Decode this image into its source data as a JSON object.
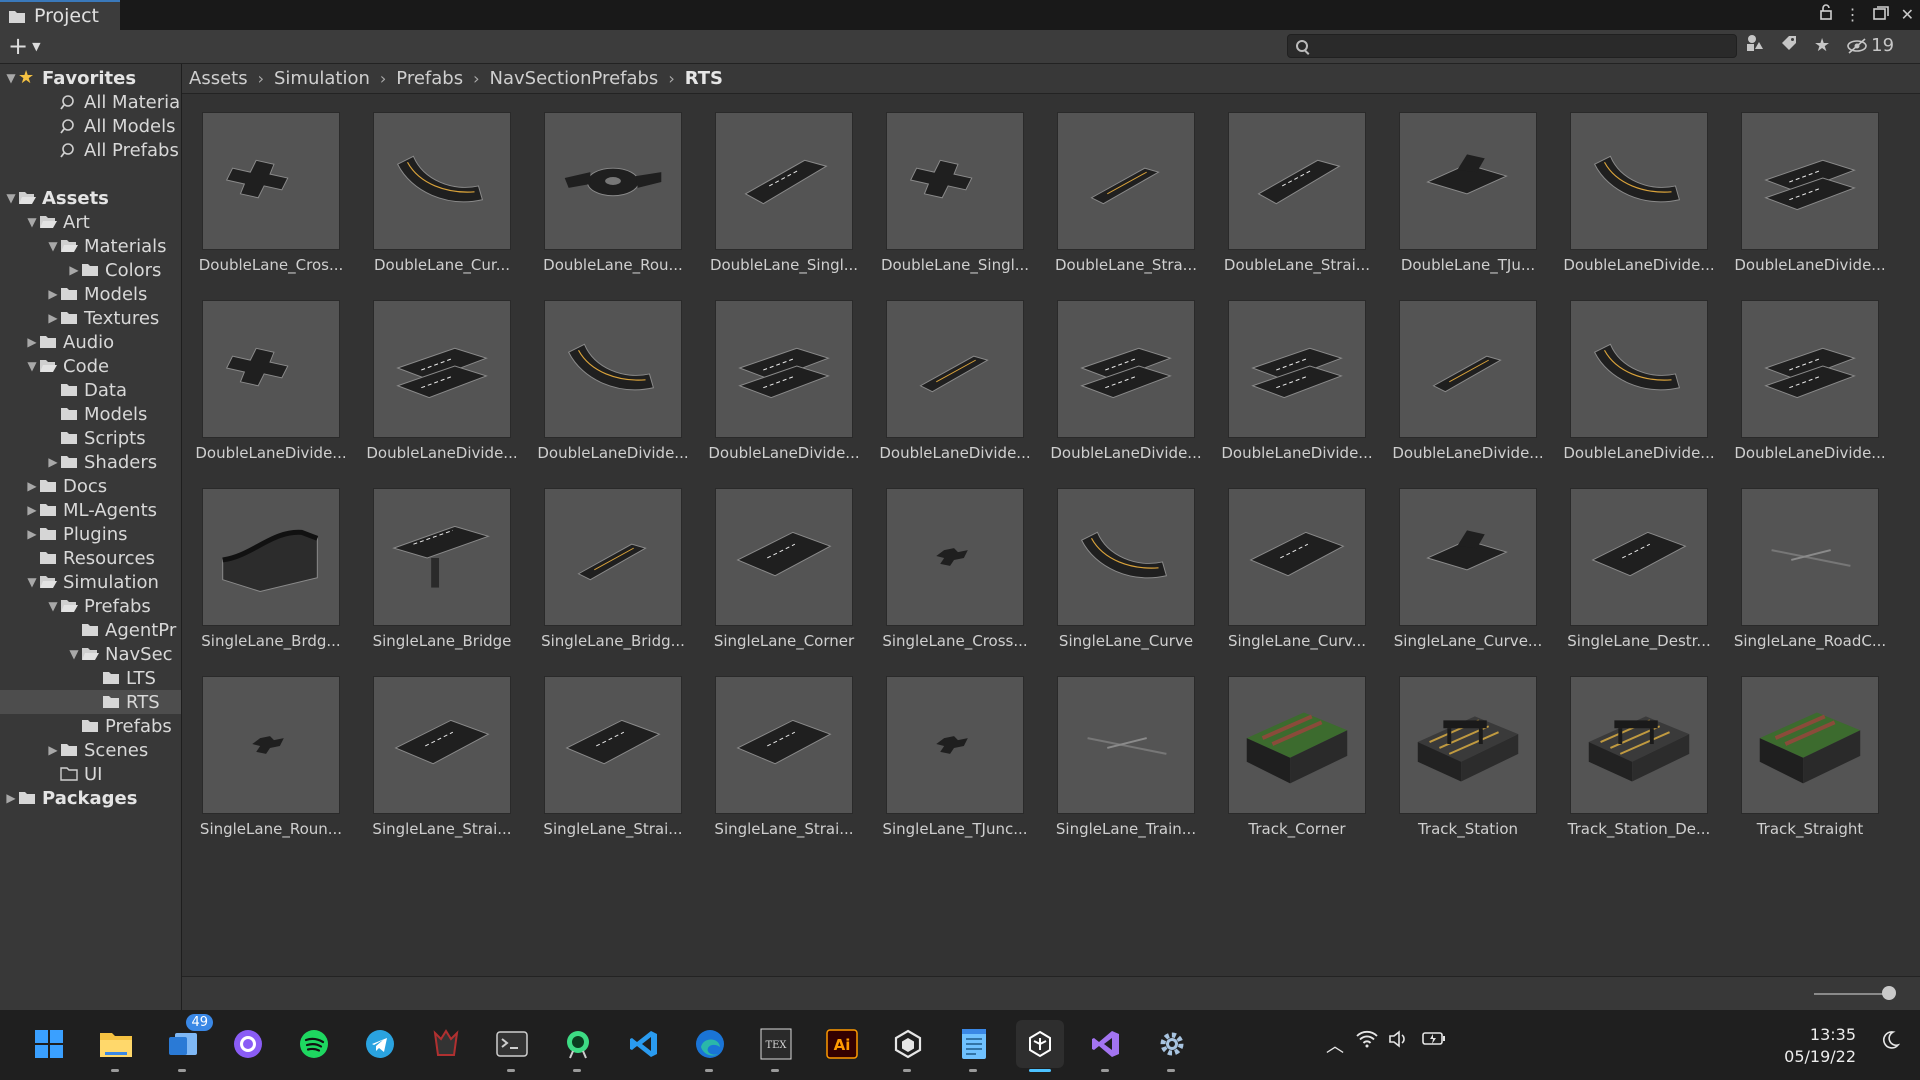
{
  "window": {
    "tab_label": "Project",
    "tab_icon": "folder-icon"
  },
  "toolbar": {
    "add_label": "+",
    "search_placeholder": "",
    "hidden_count": "19"
  },
  "sidebar": {
    "items": [
      {
        "label": "Favorites",
        "depth": 0,
        "arrow": "open",
        "icon": "star",
        "bold": true
      },
      {
        "label": "All Materials",
        "depth": 2,
        "arrow": "",
        "icon": "search"
      },
      {
        "label": "All Models",
        "depth": 2,
        "arrow": "",
        "icon": "search"
      },
      {
        "label": "All Prefabs",
        "depth": 2,
        "arrow": "",
        "icon": "search"
      },
      {
        "label": "",
        "depth": 0,
        "arrow": "",
        "icon": "none"
      },
      {
        "label": "Assets",
        "depth": 0,
        "arrow": "open",
        "icon": "folder-open",
        "bold": true
      },
      {
        "label": "Art",
        "depth": 1,
        "arrow": "open",
        "icon": "folder-open"
      },
      {
        "label": "Materials",
        "depth": 2,
        "arrow": "open",
        "icon": "folder-open"
      },
      {
        "label": "Colors",
        "depth": 3,
        "arrow": "closed",
        "icon": "folder"
      },
      {
        "label": "Models",
        "depth": 2,
        "arrow": "closed",
        "icon": "folder"
      },
      {
        "label": "Textures",
        "depth": 2,
        "arrow": "closed",
        "icon": "folder"
      },
      {
        "label": "Audio",
        "depth": 1,
        "arrow": "closed",
        "icon": "folder"
      },
      {
        "label": "Code",
        "depth": 1,
        "arrow": "open",
        "icon": "folder-open"
      },
      {
        "label": "Data",
        "depth": 2,
        "arrow": "",
        "icon": "folder"
      },
      {
        "label": "Models",
        "depth": 2,
        "arrow": "",
        "icon": "folder"
      },
      {
        "label": "Scripts",
        "depth": 2,
        "arrow": "",
        "icon": "folder"
      },
      {
        "label": "Shaders",
        "depth": 2,
        "arrow": "closed",
        "icon": "folder"
      },
      {
        "label": "Docs",
        "depth": 1,
        "arrow": "closed",
        "icon": "folder"
      },
      {
        "label": "ML-Agents",
        "depth": 1,
        "arrow": "closed",
        "icon": "folder"
      },
      {
        "label": "Plugins",
        "depth": 1,
        "arrow": "closed",
        "icon": "folder"
      },
      {
        "label": "Resources",
        "depth": 1,
        "arrow": "",
        "icon": "folder"
      },
      {
        "label": "Simulation",
        "depth": 1,
        "arrow": "open",
        "icon": "folder-open"
      },
      {
        "label": "Prefabs",
        "depth": 2,
        "arrow": "open",
        "icon": "folder-open"
      },
      {
        "label": "AgentPr",
        "depth": 3,
        "arrow": "",
        "icon": "folder"
      },
      {
        "label": "NavSec",
        "depth": 3,
        "arrow": "open",
        "icon": "folder-open"
      },
      {
        "label": "LTS",
        "depth": 4,
        "arrow": "",
        "icon": "folder"
      },
      {
        "label": "RTS",
        "depth": 4,
        "arrow": "",
        "icon": "folder",
        "selected": true
      },
      {
        "label": "Prefabs",
        "depth": 3,
        "arrow": "",
        "icon": "folder"
      },
      {
        "label": "Scenes",
        "depth": 2,
        "arrow": "closed",
        "icon": "folder"
      },
      {
        "label": "UI",
        "depth": 2,
        "arrow": "",
        "icon": "folder-empty"
      },
      {
        "label": "Packages",
        "depth": 0,
        "arrow": "closed",
        "icon": "folder",
        "bold": true
      }
    ]
  },
  "breadcrumb": [
    "Assets",
    "Simulation",
    "Prefabs",
    "NavSectionPrefabs",
    "RTS"
  ],
  "assets": [
    {
      "name": "DoubleLane_Cros...",
      "shape": "cross"
    },
    {
      "name": "DoubleLane_Cur...",
      "shape": "curve"
    },
    {
      "name": "DoubleLane_Rou...",
      "shape": "round"
    },
    {
      "name": "DoubleLane_Singl...",
      "shape": "wide"
    },
    {
      "name": "DoubleLane_Singl...",
      "shape": "cross"
    },
    {
      "name": "DoubleLane_Stra...",
      "shape": "strip"
    },
    {
      "name": "DoubleLane_Strai...",
      "shape": "wide"
    },
    {
      "name": "DoubleLane_TJu...",
      "shape": "tj"
    },
    {
      "name": "DoubleLaneDivide...",
      "shape": "curve"
    },
    {
      "name": "DoubleLaneDivide...",
      "shape": "double"
    },
    {
      "name": "DoubleLaneDivide...",
      "shape": "cross"
    },
    {
      "name": "DoubleLaneDivide...",
      "shape": "double"
    },
    {
      "name": "DoubleLaneDivide...",
      "shape": "curve"
    },
    {
      "name": "DoubleLaneDivide...",
      "shape": "double"
    },
    {
      "name": "DoubleLaneDivide...",
      "shape": "strip"
    },
    {
      "name": "DoubleLaneDivide...",
      "shape": "double"
    },
    {
      "name": "DoubleLaneDivide...",
      "shape": "double"
    },
    {
      "name": "DoubleLaneDivide...",
      "shape": "strip"
    },
    {
      "name": "DoubleLaneDivide...",
      "shape": "curve"
    },
    {
      "name": "DoubleLaneDivide...",
      "shape": "double"
    },
    {
      "name": "SingleLane_Brdg...",
      "shape": "ramp"
    },
    {
      "name": "SingleLane_Bridge",
      "shape": "bridge"
    },
    {
      "name": "SingleLane_Bridg...",
      "shape": "strip"
    },
    {
      "name": "SingleLane_Corner",
      "shape": "plate"
    },
    {
      "name": "SingleLane_Cross...",
      "shape": "small"
    },
    {
      "name": "SingleLane_Curve",
      "shape": "curve"
    },
    {
      "name": "SingleLane_Curv...",
      "shape": "plate"
    },
    {
      "name": "SingleLane_Curve...",
      "shape": "tj"
    },
    {
      "name": "SingleLane_Destr...",
      "shape": "plate"
    },
    {
      "name": "SingleLane_RoadC...",
      "shape": "line"
    },
    {
      "name": "SingleLane_Roun...",
      "shape": "small"
    },
    {
      "name": "SingleLane_Strai...",
      "shape": "plate"
    },
    {
      "name": "SingleLane_Strai...",
      "shape": "plate"
    },
    {
      "name": "SingleLane_Strai...",
      "shape": "plate"
    },
    {
      "name": "SingleLane_TJunc...",
      "shape": "small"
    },
    {
      "name": "SingleLane_Train...",
      "shape": "line"
    },
    {
      "name": "Track_Corner",
      "shape": "track-green"
    },
    {
      "name": "Track_Station",
      "shape": "track-station"
    },
    {
      "name": "Track_Station_De...",
      "shape": "track-station"
    },
    {
      "name": "Track_Straight",
      "shape": "track-green"
    }
  ],
  "taskbar": {
    "apps": [
      {
        "name": "windows-start-icon",
        "color": "#3aa0ff"
      },
      {
        "name": "file-explorer-icon",
        "color": "#f5c242"
      },
      {
        "name": "outlook-icon",
        "color": "#2a7ad6",
        "badge": "49"
      },
      {
        "name": "github-desktop-icon",
        "color": "#8a5cf5"
      },
      {
        "name": "spotify-icon",
        "color": "#1ed760"
      },
      {
        "name": "telegram-icon",
        "color": "#2aa3e0"
      },
      {
        "name": "game-icon",
        "color": "#b03030"
      },
      {
        "name": "terminal-icon",
        "color": "#cfcfcf"
      },
      {
        "name": "android-studio-icon",
        "color": "#3ddc84"
      },
      {
        "name": "vscode-icon",
        "color": "#2a9bf0"
      },
      {
        "name": "edge-icon",
        "color": "#2ab7a9"
      },
      {
        "name": "texmaker-icon",
        "color": "#d9d9d9"
      },
      {
        "name": "illustrator-icon",
        "color": "#ff9a00"
      },
      {
        "name": "unity-hub-icon",
        "color": "#e6e6e6"
      },
      {
        "name": "notepad-icon",
        "color": "#6fc1ff"
      },
      {
        "name": "unity-editor-icon",
        "color": "#ffffff",
        "active": true
      },
      {
        "name": "visual-studio-icon",
        "color": "#a374f0"
      },
      {
        "name": "settings-icon",
        "color": "#a8c4e0"
      }
    ],
    "time": "13:35",
    "date": "05/19/22"
  }
}
